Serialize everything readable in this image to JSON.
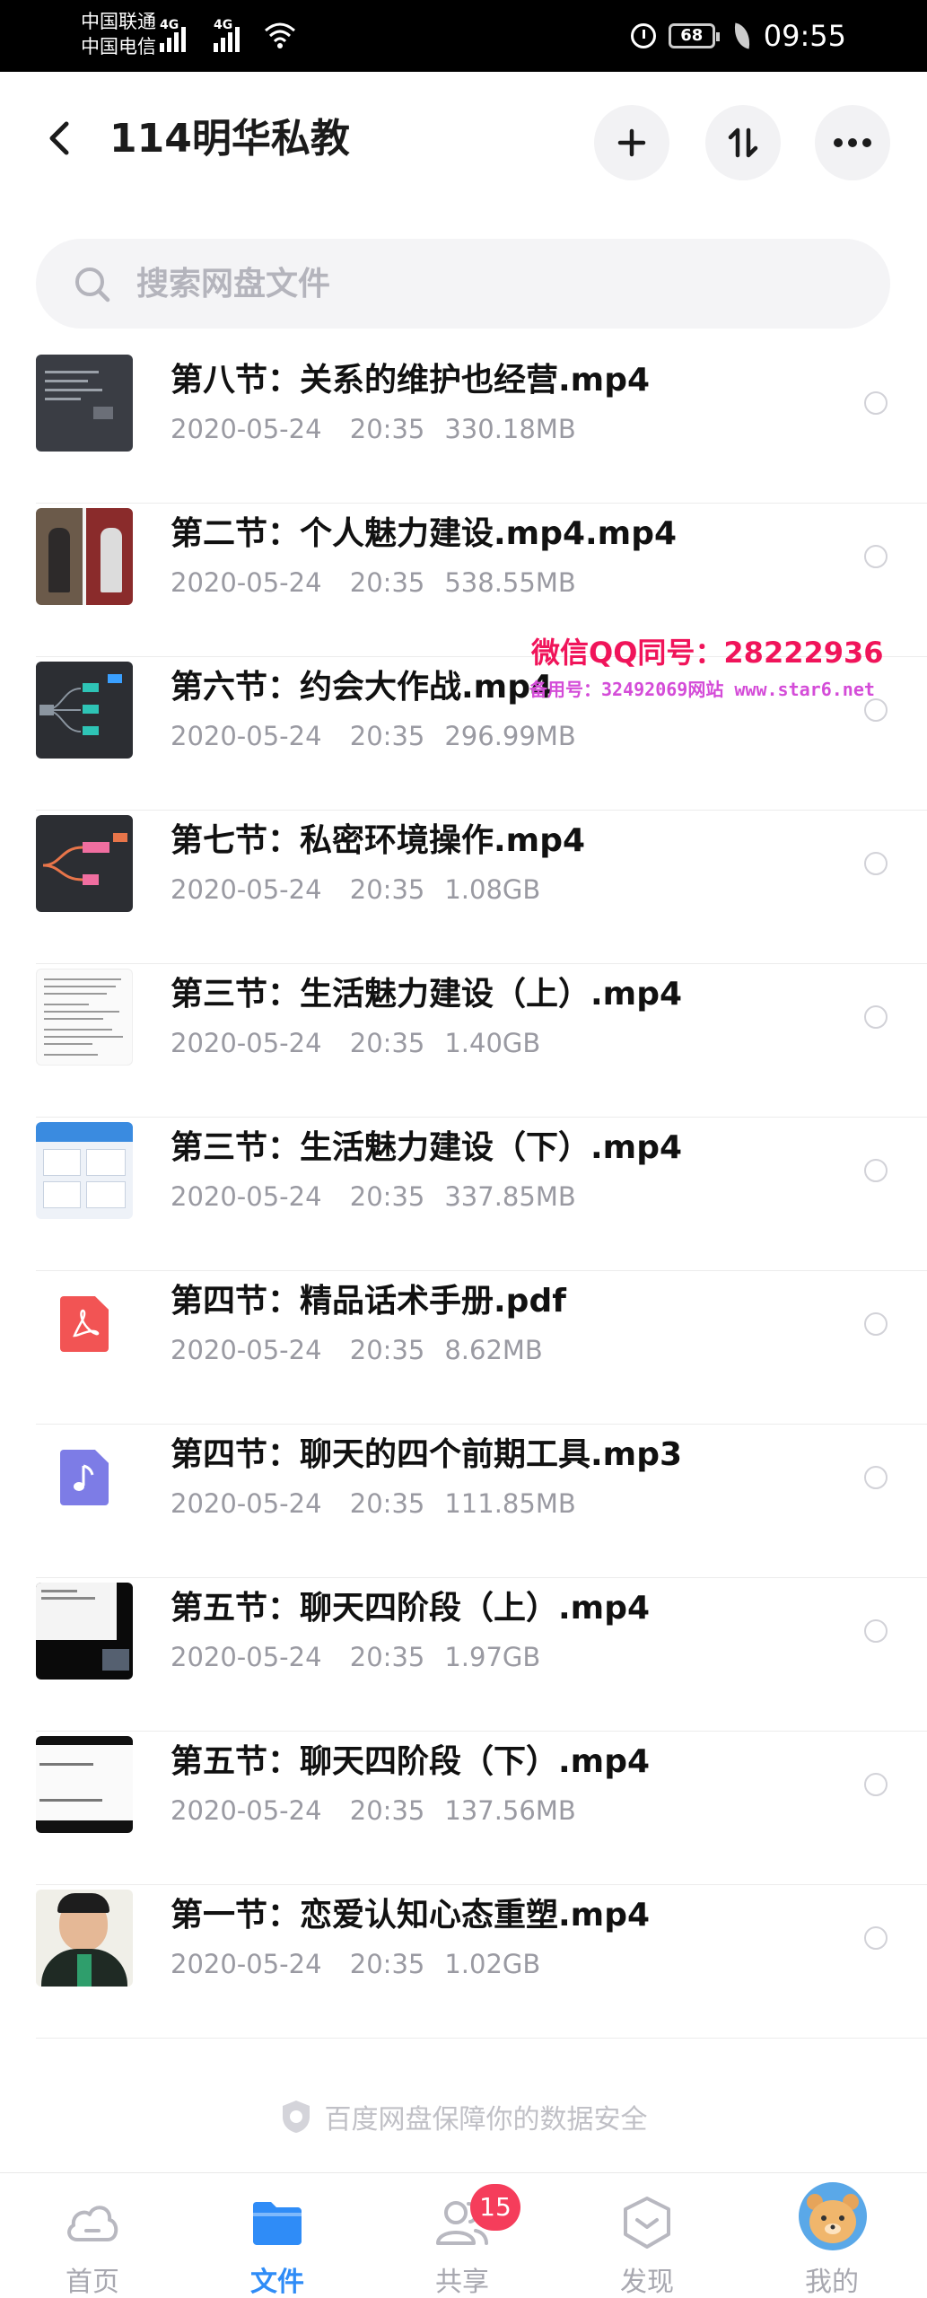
{
  "status_bar": {
    "carrier_1": "中国联通",
    "carrier_2": "中国电信",
    "network_1": "4G",
    "network_2": "4G",
    "battery": "68",
    "time": "09:55"
  },
  "header": {
    "title": "114明华私教",
    "actions": [
      "back-icon",
      "plus-icon",
      "sort-icon",
      "more-icon"
    ]
  },
  "search": {
    "placeholder": "搜索网盘文件",
    "value": ""
  },
  "files": [
    {
      "name": "第八节：关系的维护也经营.mp4",
      "date": "2020-05-24",
      "time": "20:35",
      "size": "330.18MB",
      "thumb": "video-dark"
    },
    {
      "name": "第二节：个人魅力建设.mp4.mp4",
      "date": "2020-05-24",
      "time": "20:35",
      "size": "538.55MB",
      "thumb": "video-photo"
    },
    {
      "name": "第六节：约会大作战.mp4",
      "date": "2020-05-24",
      "time": "20:35",
      "size": "296.99MB",
      "thumb": "video-mindmap"
    },
    {
      "name": "第七节：私密环境操作.mp4",
      "date": "2020-05-24",
      "time": "20:35",
      "size": "1.08GB",
      "thumb": "video-mindmap-2"
    },
    {
      "name": "第三节：生活魅力建设（上）.mp4",
      "date": "2020-05-24",
      "time": "20:35",
      "size": "1.40GB",
      "thumb": "video-doc"
    },
    {
      "name": "第三节：生活魅力建设（下）.mp4",
      "date": "2020-05-24",
      "time": "20:35",
      "size": "337.85MB",
      "thumb": "video-web"
    },
    {
      "name": "第四节：精品话术手册.pdf",
      "date": "2020-05-24",
      "time": "20:35",
      "size": "8.62MB",
      "thumb": "pdf-icon"
    },
    {
      "name": "第四节：聊天的四个前期工具.mp3",
      "date": "2020-05-24",
      "time": "20:35",
      "size": "111.85MB",
      "thumb": "music-icon"
    },
    {
      "name": "第五节：聊天四阶段（上）.mp4",
      "date": "2020-05-24",
      "time": "20:35",
      "size": "1.97GB",
      "thumb": "video-black"
    },
    {
      "name": "第五节：聊天四阶段（下）.mp4",
      "date": "2020-05-24",
      "time": "20:35",
      "size": "137.56MB",
      "thumb": "video-slide"
    },
    {
      "name": "第一节：恋爱认知心态重塑.mp4",
      "date": "2020-05-24",
      "time": "20:35",
      "size": "1.02GB",
      "thumb": "video-face"
    }
  ],
  "watermark": {
    "line1": "微信QQ同号：28222936",
    "line2": "备用号：32492069网站 www.star6.net"
  },
  "footer": {
    "safety_text": "百度网盘保障你的数据安全"
  },
  "tabs": [
    {
      "label": "首页",
      "icon": "cloud-icon",
      "active": false
    },
    {
      "label": "文件",
      "icon": "folder-icon",
      "active": true
    },
    {
      "label": "共享",
      "icon": "share-people-icon",
      "active": false,
      "badge": "15"
    },
    {
      "label": "发现",
      "icon": "discover-icon",
      "active": false
    },
    {
      "label": "我的",
      "icon": "avatar",
      "active": false
    }
  ],
  "colors": {
    "accent": "#2f8cf7",
    "badge": "#f53d5b",
    "watermark_red": "#f0145a",
    "watermark_purple": "#d44cd8",
    "pdf": "#f25454",
    "mp3": "#7d7ce6"
  }
}
